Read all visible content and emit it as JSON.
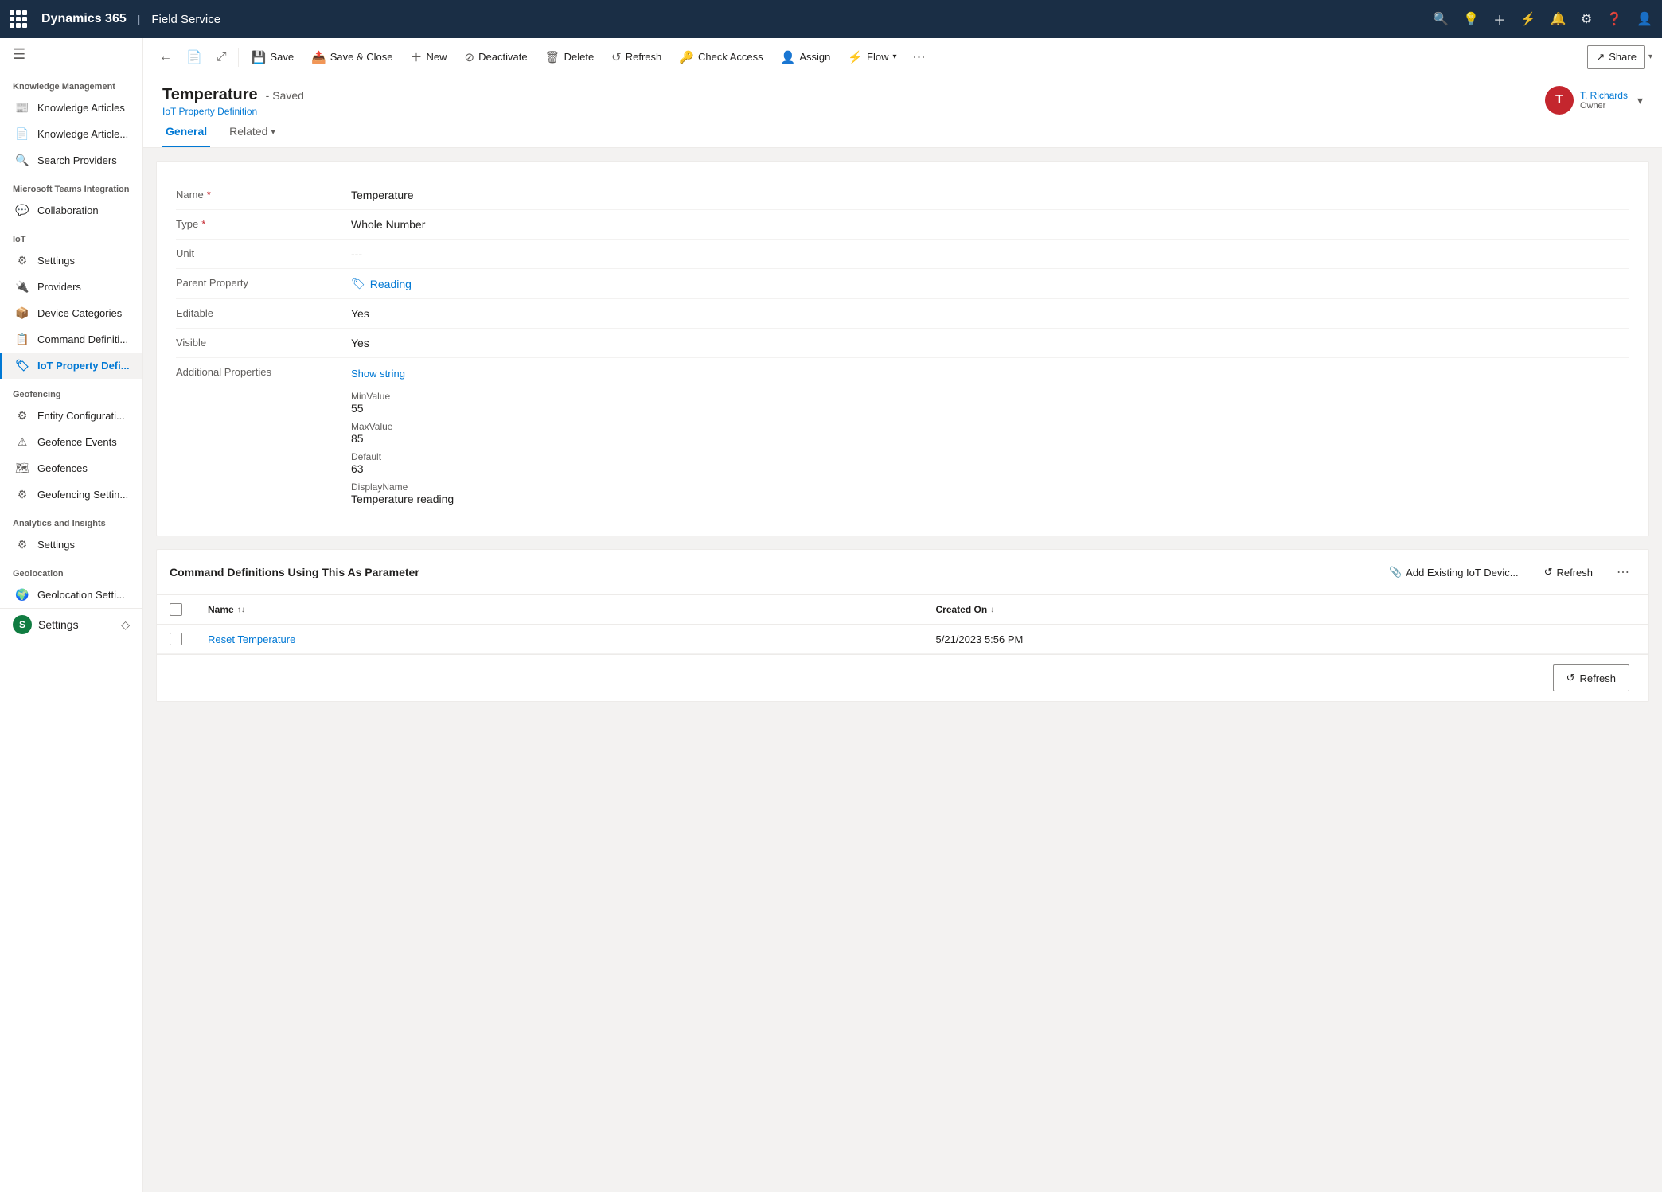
{
  "topNav": {
    "title": "Dynamics 365",
    "separator": "|",
    "appName": "Field Service"
  },
  "toolbar": {
    "back": "←",
    "record_icon": "📄",
    "share_icon": "⤢",
    "save_label": "Save",
    "save_close_label": "Save & Close",
    "new_label": "New",
    "deactivate_label": "Deactivate",
    "delete_label": "Delete",
    "refresh_label": "Refresh",
    "check_access_label": "Check Access",
    "assign_label": "Assign",
    "flow_label": "Flow",
    "more": "⋯",
    "share_label": "Share"
  },
  "pageHeader": {
    "title": "Temperature",
    "saved_label": "- Saved",
    "subtitle": "IoT Property Definition",
    "owner_initial": "T",
    "owner_name": "T. Richards",
    "owner_label": "Owner"
  },
  "tabs": {
    "general": "General",
    "related": "Related"
  },
  "form": {
    "fields": [
      {
        "label": "Name",
        "required": true,
        "value": "Temperature",
        "type": "text"
      },
      {
        "label": "Type",
        "required": true,
        "value": "Whole Number",
        "type": "text"
      },
      {
        "label": "Unit",
        "required": false,
        "value": "---",
        "type": "dashes"
      },
      {
        "label": "Parent Property",
        "required": false,
        "value": "Reading",
        "type": "link"
      },
      {
        "label": "Editable",
        "required": false,
        "value": "Yes",
        "type": "text"
      },
      {
        "label": "Visible",
        "required": false,
        "value": "Yes",
        "type": "text"
      }
    ],
    "additionalProperties": {
      "label": "Additional Properties",
      "show_string_label": "Show string",
      "sub_fields": [
        {
          "label": "MinValue",
          "value": "55"
        },
        {
          "label": "MaxValue",
          "value": "85"
        },
        {
          "label": "Default",
          "value": "63"
        },
        {
          "label": "DisplayName",
          "value": "Temperature reading"
        }
      ]
    }
  },
  "commandDefinitions": {
    "title": "Command Definitions Using This As Parameter",
    "add_existing_label": "Add Existing IoT Devic...",
    "refresh_label": "Refresh",
    "more": "⋯",
    "columns": [
      {
        "label": "Name",
        "sort": "↑↓"
      },
      {
        "label": "Created On",
        "sort": "↓"
      }
    ],
    "rows": [
      {
        "name": "Reset Temperature",
        "created_on": "5/21/2023 5:56 PM"
      }
    ]
  },
  "sidebar": {
    "hamburger": "☰",
    "sections": [
      {
        "title": "Knowledge Management",
        "items": [
          {
            "label": "Knowledge Articles",
            "icon": "📰",
            "active": false
          },
          {
            "label": "Knowledge Article...",
            "icon": "📄",
            "active": false
          },
          {
            "label": "Search Providers",
            "icon": "🔍",
            "active": false
          }
        ]
      },
      {
        "title": "Microsoft Teams Integration",
        "items": [
          {
            "label": "Collaboration",
            "icon": "💬",
            "active": false
          }
        ]
      },
      {
        "title": "IoT",
        "items": [
          {
            "label": "Settings",
            "icon": "⚙",
            "active": false
          },
          {
            "label": "Providers",
            "icon": "🔌",
            "active": false
          },
          {
            "label": "Device Categories",
            "icon": "📦",
            "active": false
          },
          {
            "label": "Command Definiti...",
            "icon": "📋",
            "active": false
          },
          {
            "label": "IoT Property Defi...",
            "icon": "🏷",
            "active": true
          }
        ]
      },
      {
        "title": "Geofencing",
        "items": [
          {
            "label": "Entity Configurati...",
            "icon": "⚙",
            "active": false
          },
          {
            "label": "Geofence Events",
            "icon": "⚠",
            "active": false
          },
          {
            "label": "Geofences",
            "icon": "🗺",
            "active": false
          },
          {
            "label": "Geofencing Settin...",
            "icon": "⚙",
            "active": false
          }
        ]
      },
      {
        "title": "Analytics and Insights",
        "items": [
          {
            "label": "Settings",
            "icon": "⚙",
            "active": false
          }
        ]
      },
      {
        "title": "Geolocation",
        "items": [
          {
            "label": "Geolocation Setti...",
            "icon": "🌍",
            "active": false
          }
        ]
      }
    ],
    "bottom_item": {
      "label": "Settings",
      "icon": "S"
    }
  },
  "bottomBar": {
    "refresh_label": "Refresh"
  }
}
